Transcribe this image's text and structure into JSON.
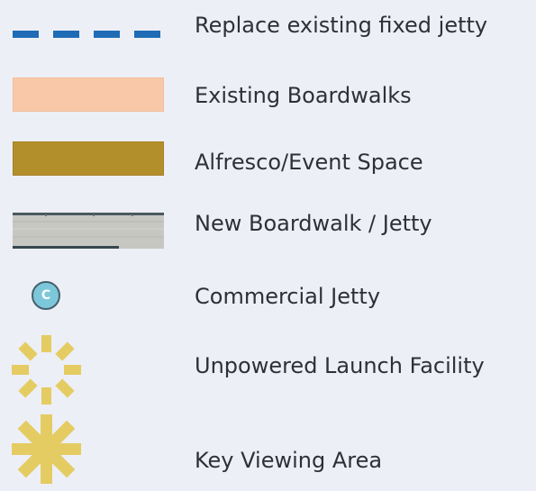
{
  "legend": {
    "items": [
      {
        "id": "replace_existing_fixed_jetty",
        "label": "Replace existing fixed jetty",
        "symbol": "dashed-line",
        "color": "#1f6bb5"
      },
      {
        "id": "existing_boardwalks",
        "label": "Existing Boardwalks",
        "symbol": "swatch",
        "color": "#f9c8a8"
      },
      {
        "id": "alfresco_event_space",
        "label": "Alfresco/Event Space",
        "symbol": "swatch",
        "color": "#b38f2b"
      },
      {
        "id": "new_boardwalk_jetty",
        "label": "New Boardwalk / Jetty",
        "symbol": "texture-swatch",
        "color": "#c7c7c2",
        "accent_color": "#36474f"
      },
      {
        "id": "commercial_jetty",
        "label": "Commercial Jetty",
        "symbol": "circle-badge",
        "badge_text": "C",
        "color": "#7cc8da",
        "border_color": "#44616c"
      },
      {
        "id": "unpowered_launch_facility",
        "label": "Unpowered Launch Facility",
        "symbol": "starburst-icon",
        "color": "#e5cc62"
      },
      {
        "id": "key_viewing_area",
        "label": "Key Viewing Area",
        "symbol": "asterisk-icon",
        "color": "#e5cc62"
      }
    ]
  }
}
